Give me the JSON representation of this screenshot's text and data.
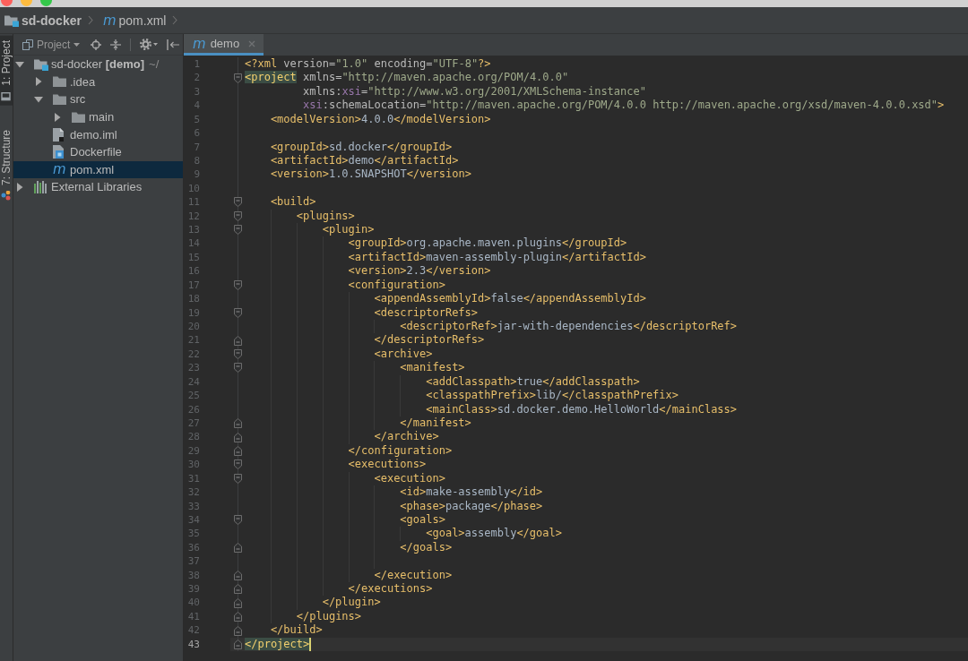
{
  "navigation_bar": {
    "breadcrumbs": [
      {
        "label": "sd-docker",
        "kind": "module"
      },
      {
        "label": "pom.xml",
        "kind": "maven",
        "glyph": "m"
      }
    ]
  },
  "tool_window_buttons": [
    {
      "label": "1: Project",
      "kind": "project",
      "selected": true
    },
    {
      "label": "7: Structure",
      "kind": "structure",
      "selected": false
    }
  ],
  "project_panel": {
    "view_selector": {
      "label": "Project"
    },
    "tree": [
      {
        "name": "sd-docker **[demo]**",
        "path": "~/",
        "kind": "module",
        "expanded": true,
        "selected": false,
        "children": [
          {
            "name": ".idea",
            "kind": "folder",
            "expanded": false,
            "selected": false
          },
          {
            "name": "src",
            "kind": "folder",
            "expanded": true,
            "selected": false,
            "children": [
              {
                "name": "main",
                "kind": "folder",
                "expanded": false,
                "selected": false
              }
            ]
          },
          {
            "name": "demo.iml",
            "kind": "iml",
            "selected": false
          },
          {
            "name": "Dockerfile",
            "kind": "docker",
            "selected": false
          },
          {
            "name": "pom.xml",
            "kind": "maven",
            "glyph": "m",
            "selected": true
          }
        ]
      },
      {
        "name": "External Libraries",
        "kind": "libraries",
        "expanded": false,
        "selected": false
      }
    ]
  },
  "editor": {
    "tabs": [
      {
        "label": "demo",
        "glyph": "m",
        "selected": true
      }
    ],
    "code": [
      {
        "number": "1",
        "current": false,
        "tokens": [
          {
            "kind": "tag",
            "text": "<?xml"
          },
          {
            "kind": "attr",
            "text": " version="
          },
          {
            "kind": "value",
            "text": "\"1.0\""
          },
          {
            "kind": "attr",
            "text": " encoding="
          },
          {
            "kind": "value",
            "text": "\"UTF-8\""
          },
          {
            "kind": "tag",
            "text": "?>"
          }
        ]
      },
      {
        "number": "2",
        "current": false,
        "tokens": [
          {
            "kind": "match",
            "text": "<project"
          },
          {
            "kind": "attr",
            "text": " xmlns="
          },
          {
            "kind": "value",
            "text": "\"http://maven.apache.org/POM/4.0.0\""
          }
        ],
        "continuation": [
          {
            "number": "3",
            "current": false,
            "tokens": [
              {
                "kind": "attr",
                "text": "xmlns:"
              },
              {
                "kind": "ns",
                "text": "xsi"
              },
              {
                "kind": "attr",
                "text": "="
              },
              {
                "kind": "value",
                "text": "\"http://www.w3.org/2001/XMLSchema-instance\""
              }
            ]
          },
          {
            "number": "4",
            "current": false,
            "tokens": [
              {
                "kind": "ns",
                "text": "xsi"
              },
              {
                "kind": "attr",
                "text": ":schemaLocation="
              },
              {
                "kind": "value",
                "text": "\"http://maven.apache.org/POM/4.0.0 http://maven.apache.org/xsd/maven-4.0.0.xsd\""
              },
              {
                "kind": "tag",
                "text": ">"
              }
            ]
          }
        ],
        "children": [
          {
            "number": "5",
            "current": false,
            "tokens": [
              {
                "kind": "tag",
                "text": "<modelVersion>"
              },
              {
                "kind": "text",
                "text": "4.0.0"
              },
              {
                "kind": "tag",
                "text": "</modelVersion>"
              }
            ]
          },
          {
            "number": "6",
            "current": false
          },
          {
            "number": "7",
            "current": false,
            "tokens": [
              {
                "kind": "tag",
                "text": "<groupId>"
              },
              {
                "kind": "text",
                "text": "sd.docker"
              },
              {
                "kind": "tag",
                "text": "</groupId>"
              }
            ]
          },
          {
            "number": "8",
            "current": false,
            "tokens": [
              {
                "kind": "tag",
                "text": "<artifactId>"
              },
              {
                "kind": "text",
                "text": "demo"
              },
              {
                "kind": "tag",
                "text": "</artifactId>"
              }
            ]
          },
          {
            "number": "9",
            "current": false,
            "tokens": [
              {
                "kind": "tag",
                "text": "<version>"
              },
              {
                "kind": "text",
                "text": "1.0.SNAPSHOT"
              },
              {
                "kind": "tag",
                "text": "</version>"
              }
            ]
          },
          {
            "number": "10",
            "current": false
          },
          {
            "number": "11",
            "current": false,
            "tokens": [
              {
                "kind": "tag",
                "text": "<build>"
              }
            ],
            "children": [
              {
                "number": "12",
                "current": false,
                "tokens": [
                  {
                    "kind": "tag",
                    "text": "<plugins>"
                  }
                ],
                "children": [
                  {
                    "number": "13",
                    "current": false,
                    "tokens": [
                      {
                        "kind": "tag",
                        "text": "<plugin>"
                      }
                    ],
                    "children": [
                      {
                        "number": "14",
                        "current": false,
                        "tokens": [
                          {
                            "kind": "tag",
                            "text": "<groupId>"
                          },
                          {
                            "kind": "text",
                            "text": "org.apache.maven.plugins"
                          },
                          {
                            "kind": "tag",
                            "text": "</groupId>"
                          }
                        ]
                      },
                      {
                        "number": "15",
                        "current": false,
                        "tokens": [
                          {
                            "kind": "tag",
                            "text": "<artifactId>"
                          },
                          {
                            "kind": "text",
                            "text": "maven-assembly-plugin"
                          },
                          {
                            "kind": "tag",
                            "text": "</artifactId>"
                          }
                        ]
                      },
                      {
                        "number": "16",
                        "current": false,
                        "tokens": [
                          {
                            "kind": "tag",
                            "text": "<version>"
                          },
                          {
                            "kind": "text",
                            "text": "2.3"
                          },
                          {
                            "kind": "tag",
                            "text": "</version>"
                          }
                        ]
                      },
                      {
                        "number": "17",
                        "current": false,
                        "tokens": [
                          {
                            "kind": "tag",
                            "text": "<configuration>"
                          }
                        ],
                        "children": [
                          {
                            "number": "18",
                            "current": false,
                            "tokens": [
                              {
                                "kind": "tag",
                                "text": "<appendAssemblyId>"
                              },
                              {
                                "kind": "text",
                                "text": "false"
                              },
                              {
                                "kind": "tag",
                                "text": "</appendAssemblyId>"
                              }
                            ]
                          },
                          {
                            "number": "19",
                            "current": false,
                            "tokens": [
                              {
                                "kind": "tag",
                                "text": "<descriptorRefs>"
                              }
                            ],
                            "children": [
                              {
                                "number": "20",
                                "current": false,
                                "tokens": [
                                  {
                                    "kind": "tag",
                                    "text": "<descriptorRef>"
                                  },
                                  {
                                    "kind": "text",
                                    "text": "jar-with-dependencies"
                                  },
                                  {
                                    "kind": "tag",
                                    "text": "</descriptorRef>"
                                  }
                                ]
                              }
                            ],
                            "close": {
                              "number": "21",
                              "current": false,
                              "tokens": [
                                {
                                  "kind": "tag",
                                  "text": "</descriptorRefs>"
                                }
                              ]
                            }
                          },
                          {
                            "number": "22",
                            "current": false,
                            "tokens": [
                              {
                                "kind": "tag",
                                "text": "<archive>"
                              }
                            ],
                            "children": [
                              {
                                "number": "23",
                                "current": false,
                                "tokens": [
                                  {
                                    "kind": "tag",
                                    "text": "<manifest>"
                                  }
                                ],
                                "children": [
                                  {
                                    "number": "24",
                                    "current": false,
                                    "tokens": [
                                      {
                                        "kind": "tag",
                                        "text": "<addClasspath>"
                                      },
                                      {
                                        "kind": "text",
                                        "text": "true"
                                      },
                                      {
                                        "kind": "tag",
                                        "text": "</addClasspath>"
                                      }
                                    ]
                                  },
                                  {
                                    "number": "25",
                                    "current": false,
                                    "tokens": [
                                      {
                                        "kind": "tag",
                                        "text": "<classpathPrefix>"
                                      },
                                      {
                                        "kind": "text",
                                        "text": "lib/"
                                      },
                                      {
                                        "kind": "tag",
                                        "text": "</classpathPrefix>"
                                      }
                                    ]
                                  },
                                  {
                                    "number": "26",
                                    "current": false,
                                    "tokens": [
                                      {
                                        "kind": "tag",
                                        "text": "<mainClass>"
                                      },
                                      {
                                        "kind": "text",
                                        "text": "sd.docker.demo.HelloWorld"
                                      },
                                      {
                                        "kind": "tag",
                                        "text": "</mainClass>"
                                      }
                                    ]
                                  }
                                ],
                                "close": {
                                  "number": "27",
                                  "current": false,
                                  "tokens": [
                                    {
                                      "kind": "tag",
                                      "text": "</manifest>"
                                    }
                                  ]
                                }
                              }
                            ],
                            "close": {
                              "number": "28",
                              "current": false,
                              "tokens": [
                                {
                                  "kind": "tag",
                                  "text": "</archive>"
                                }
                              ]
                            }
                          }
                        ],
                        "close": {
                          "number": "29",
                          "current": false,
                          "tokens": [
                            {
                              "kind": "tag",
                              "text": "</configuration>"
                            }
                          ]
                        }
                      },
                      {
                        "number": "30",
                        "current": false,
                        "tokens": [
                          {
                            "kind": "tag",
                            "text": "<executions>"
                          }
                        ],
                        "children": [
                          {
                            "number": "31",
                            "current": false,
                            "tokens": [
                              {
                                "kind": "tag",
                                "text": "<execution>"
                              }
                            ],
                            "children": [
                              {
                                "number": "32",
                                "current": false,
                                "tokens": [
                                  {
                                    "kind": "tag",
                                    "text": "<id>"
                                  },
                                  {
                                    "kind": "text",
                                    "text": "make-assembly"
                                  },
                                  {
                                    "kind": "tag",
                                    "text": "</id>"
                                  }
                                ]
                              },
                              {
                                "number": "33",
                                "current": false,
                                "tokens": [
                                  {
                                    "kind": "tag",
                                    "text": "<phase>"
                                  },
                                  {
                                    "kind": "text",
                                    "text": "package"
                                  },
                                  {
                                    "kind": "tag",
                                    "text": "</phase>"
                                  }
                                ]
                              },
                              {
                                "number": "34",
                                "current": false,
                                "tokens": [
                                  {
                                    "kind": "tag",
                                    "text": "<goals>"
                                  }
                                ],
                                "children": [
                                  {
                                    "number": "35",
                                    "current": false,
                                    "tokens": [
                                      {
                                        "kind": "tag",
                                        "text": "<goal>"
                                      },
                                      {
                                        "kind": "text",
                                        "text": "assembly"
                                      },
                                      {
                                        "kind": "tag",
                                        "text": "</goal>"
                                      }
                                    ]
                                  }
                                ],
                                "close": {
                                  "number": "36",
                                  "current": false,
                                  "tokens": [
                                    {
                                      "kind": "tag",
                                      "text": "</goals>"
                                    }
                                  ]
                                }
                              },
                              {
                                "number": "37",
                                "current": false
                              }
                            ],
                            "close": {
                              "number": "38",
                              "current": false,
                              "tokens": [
                                {
                                  "kind": "tag",
                                  "text": "</execution>"
                                }
                              ]
                            }
                          }
                        ],
                        "close": {
                          "number": "39",
                          "current": false,
                          "tokens": [
                            {
                              "kind": "tag",
                              "text": "</executions>"
                            }
                          ]
                        }
                      }
                    ],
                    "close": {
                      "number": "40",
                      "current": false,
                      "tokens": [
                        {
                          "kind": "tag",
                          "text": "</plugin>"
                        }
                      ]
                    }
                  }
                ],
                "close": {
                  "number": "41",
                  "current": false,
                  "tokens": [
                    {
                      "kind": "tag",
                      "text": "</plugins>"
                    }
                  ]
                }
              }
            ],
            "close": {
              "number": "42",
              "current": false,
              "tokens": [
                {
                  "kind": "tag",
                  "text": "</build>"
                }
              ]
            }
          }
        ],
        "close": {
          "number": "43",
          "current": true,
          "tokens": [
            {
              "kind": "match",
              "text": "</project>"
            }
          ]
        }
      }
    ]
  }
}
